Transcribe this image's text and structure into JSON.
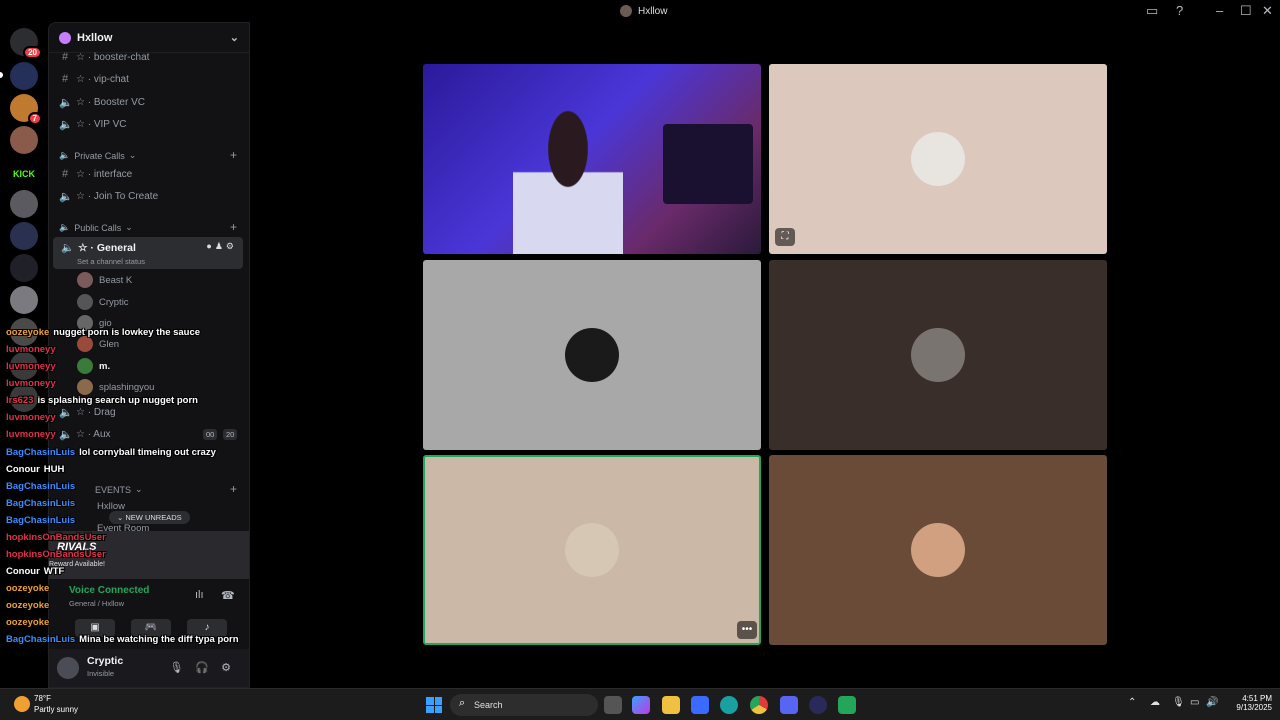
{
  "window": {
    "title": "Hxllow"
  },
  "rail": {
    "dm_badge": "20",
    "server_badge": "7",
    "kick_label": "KICK"
  },
  "sidebar": {
    "server_name": "Hxllow",
    "channels_top": [
      {
        "icon": "#",
        "label": "☆ · booster-chat"
      },
      {
        "icon": "#",
        "label": "☆ · vip-chat"
      },
      {
        "icon": "speaker",
        "label": "☆ · Booster VC"
      },
      {
        "icon": "speaker",
        "label": "☆ · VIP VC"
      }
    ],
    "cat_private": "Private Calls",
    "private_channels": [
      {
        "icon": "#",
        "label": "☆ · interface"
      },
      {
        "icon": "speaker",
        "label": "☆ · Join To Create"
      }
    ],
    "cat_public": "Public Calls",
    "general": {
      "label": "☆ · General",
      "status": "Set a channel status"
    },
    "voice_users": [
      "Beast K",
      "Cryptic",
      "gio",
      "Glen",
      "m.",
      "splashingyou"
    ],
    "channels_more": [
      {
        "label": "☆ · Drag"
      },
      {
        "label": "☆ · Aux",
        "badge_a": "00",
        "badge_b": "20"
      }
    ],
    "cat_events": "EVENTS",
    "event_users": [
      "Hxllow",
      "Event Room"
    ],
    "new_unreads": "NEW UNREADS",
    "promo": {
      "brand": "RIVALS",
      "reward": "Reward Available!"
    },
    "voice": {
      "status": "Voice Connected",
      "channel": "General / Hxllow"
    },
    "user": {
      "name": "Cryptic",
      "status": "Invisible"
    }
  },
  "chat": [
    {
      "user": "oozeyoke",
      "color": "#f0a030",
      "msg": "nugget porn is lowkey the sauce"
    },
    {
      "user": "luvmoneyy",
      "color": "#e0304a",
      "msg": ""
    },
    {
      "user": "luvmoneyy",
      "color": "#e0304a",
      "msg": ""
    },
    {
      "user": "luvmoneyy",
      "color": "#e0304a",
      "msg": ""
    },
    {
      "user": "lrs623",
      "color": "#e0304a",
      "msg": "is splashing search up nugget porn"
    },
    {
      "user": "luvmoneyy",
      "color": "#e0304a",
      "msg": ""
    },
    {
      "user": "luvmoneyy",
      "color": "#e0304a",
      "msg": ""
    },
    {
      "user": "BagChasinLuis",
      "color": "#3a8cff",
      "msg": "lol cornyball timeing out crazy"
    },
    {
      "user": "Conour",
      "color": "#ffffff",
      "msg": "HUH"
    },
    {
      "user": "BagChasinLuis",
      "color": "#3a8cff",
      "msg": ""
    },
    {
      "user": "BagChasinLuis",
      "color": "#3a8cff",
      "msg": ""
    },
    {
      "user": "BagChasinLuis",
      "color": "#3a8cff",
      "msg": ""
    },
    {
      "user": "hopkinsOnBandsUser",
      "color": "#e0304a",
      "msg": ""
    },
    {
      "user": "hopkinsOnBandsUser",
      "color": "#e0304a",
      "msg": ""
    },
    {
      "user": "Conour",
      "color": "#ffffff",
      "msg": "WTF"
    },
    {
      "user": "oozeyoke",
      "color": "#f0a030",
      "msg": ""
    },
    {
      "user": "oozeyoke",
      "color": "#f0a030",
      "msg": ""
    },
    {
      "user": "oozeyoke",
      "color": "#f0a030",
      "msg": ""
    },
    {
      "user": "BagChasinLuis",
      "color": "#3a8cff",
      "msg": "Mina be watching the diff typa porn"
    }
  ],
  "taskbar": {
    "weather_temp": "78°F",
    "weather_desc": "Partly sunny",
    "search": "Search",
    "time": "4:51 PM",
    "date": "9/13/2025"
  },
  "colors": {
    "accent": "#5865f2",
    "speaking": "#23a55a"
  }
}
